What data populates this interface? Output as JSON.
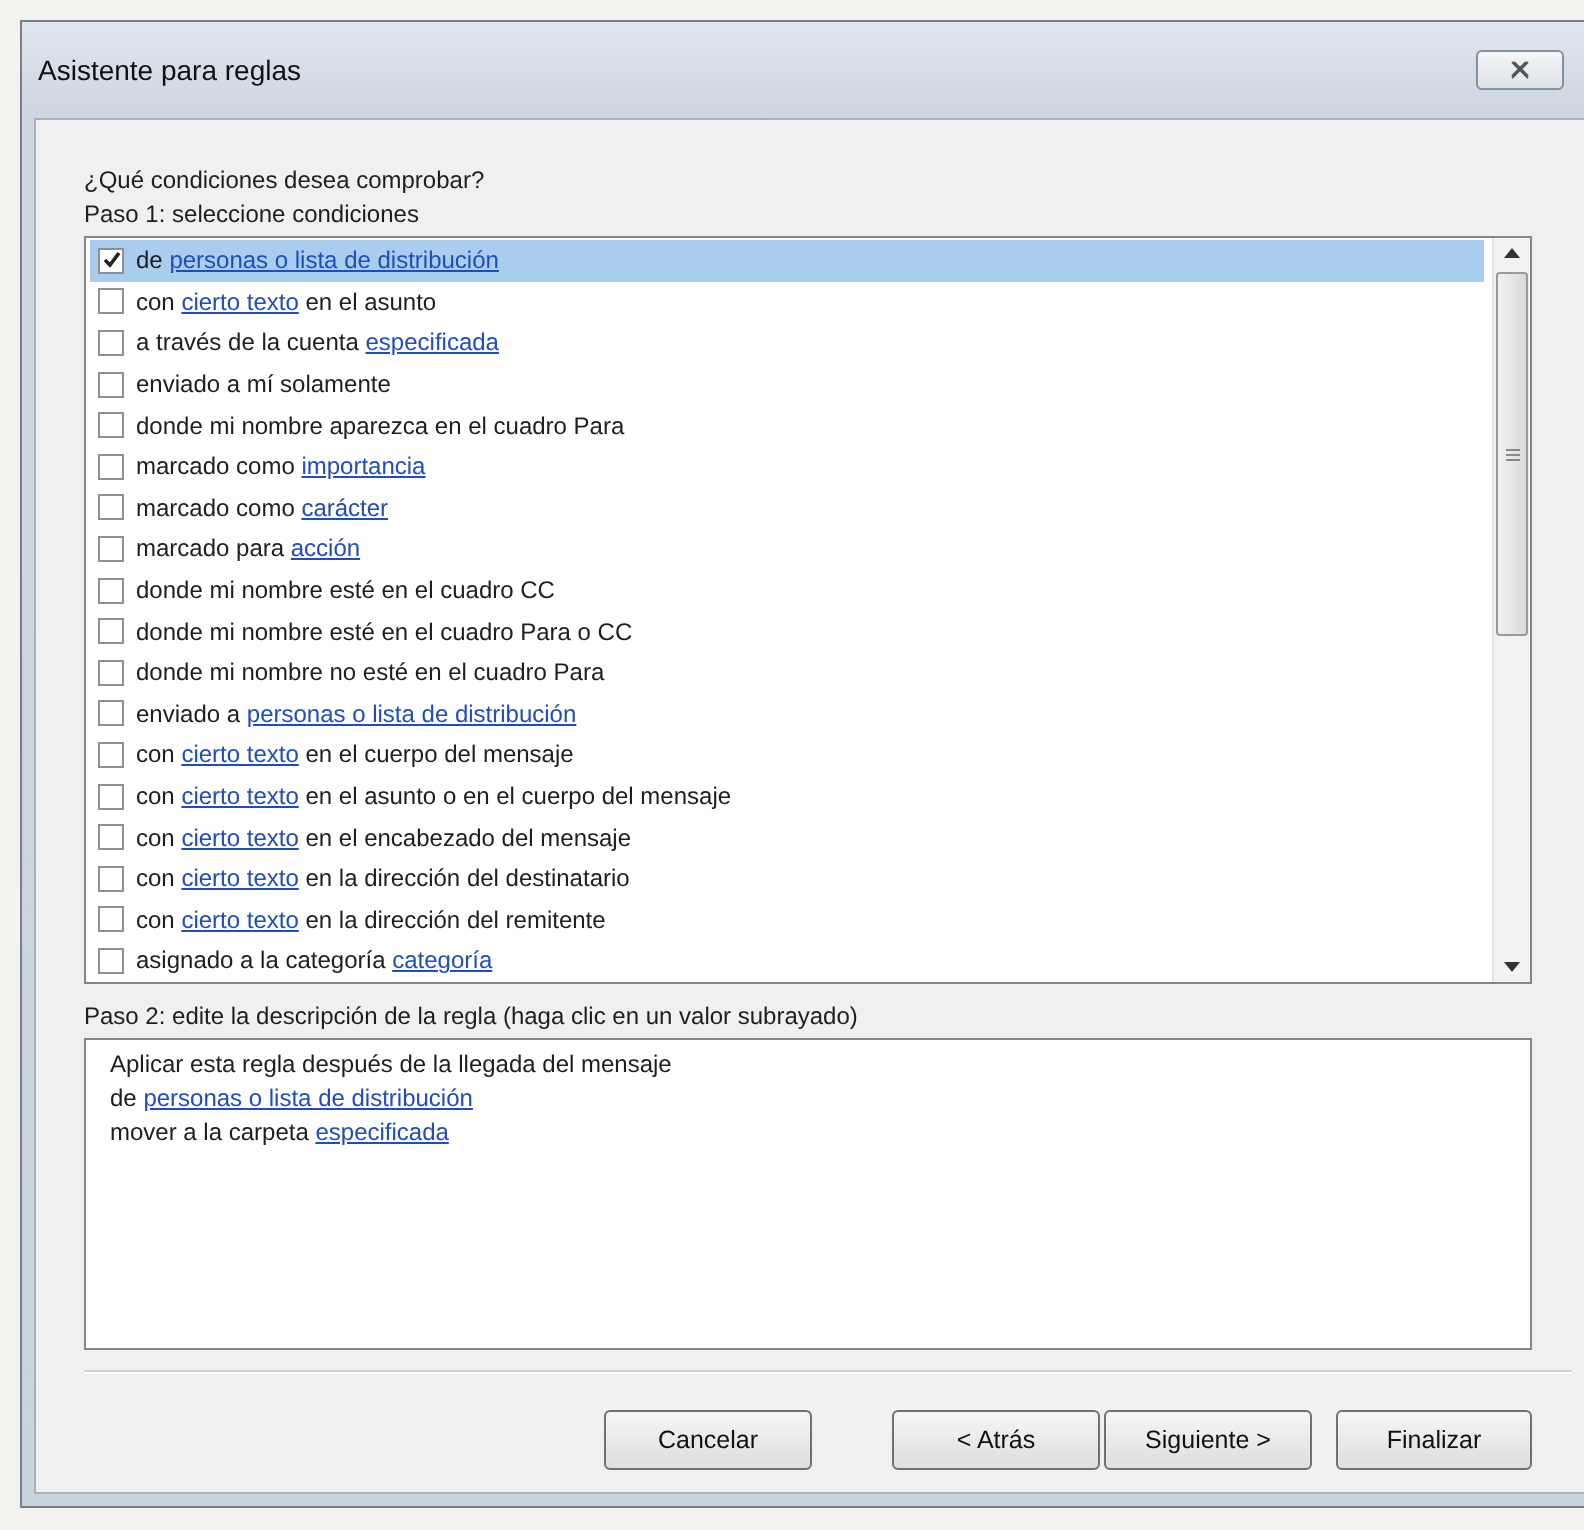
{
  "window": {
    "title": "Asistente para reglas"
  },
  "prompt": "¿Qué condiciones desea comprobar?",
  "step1": {
    "label": "Paso 1: seleccione condiciones",
    "conditions": [
      {
        "checked": true,
        "selected": true,
        "parts": [
          {
            "text": "de ",
            "link": false
          },
          {
            "text": "personas o lista de distribución",
            "link": true
          }
        ]
      },
      {
        "checked": false,
        "selected": false,
        "parts": [
          {
            "text": "con ",
            "link": false
          },
          {
            "text": "cierto texto",
            "link": true
          },
          {
            "text": " en el asunto",
            "link": false
          }
        ]
      },
      {
        "checked": false,
        "selected": false,
        "parts": [
          {
            "text": "a través de la cuenta ",
            "link": false
          },
          {
            "text": "especificada",
            "link": true
          }
        ]
      },
      {
        "checked": false,
        "selected": false,
        "parts": [
          {
            "text": "enviado a mí solamente",
            "link": false
          }
        ]
      },
      {
        "checked": false,
        "selected": false,
        "parts": [
          {
            "text": "donde mi nombre aparezca en el cuadro Para",
            "link": false
          }
        ]
      },
      {
        "checked": false,
        "selected": false,
        "parts": [
          {
            "text": "marcado como ",
            "link": false
          },
          {
            "text": "importancia",
            "link": true
          }
        ]
      },
      {
        "checked": false,
        "selected": false,
        "parts": [
          {
            "text": "marcado como ",
            "link": false
          },
          {
            "text": "carácter",
            "link": true
          }
        ]
      },
      {
        "checked": false,
        "selected": false,
        "parts": [
          {
            "text": "marcado para ",
            "link": false
          },
          {
            "text": "acción",
            "link": true
          }
        ]
      },
      {
        "checked": false,
        "selected": false,
        "parts": [
          {
            "text": "donde mi nombre esté en el cuadro CC",
            "link": false
          }
        ]
      },
      {
        "checked": false,
        "selected": false,
        "parts": [
          {
            "text": "donde mi nombre esté en el cuadro Para o CC",
            "link": false
          }
        ]
      },
      {
        "checked": false,
        "selected": false,
        "parts": [
          {
            "text": "donde mi nombre no esté en el cuadro Para",
            "link": false
          }
        ]
      },
      {
        "checked": false,
        "selected": false,
        "parts": [
          {
            "text": "enviado a ",
            "link": false
          },
          {
            "text": "personas o lista de distribución",
            "link": true
          }
        ]
      },
      {
        "checked": false,
        "selected": false,
        "parts": [
          {
            "text": "con ",
            "link": false
          },
          {
            "text": "cierto texto",
            "link": true
          },
          {
            "text": " en el cuerpo del mensaje",
            "link": false
          }
        ]
      },
      {
        "checked": false,
        "selected": false,
        "parts": [
          {
            "text": "con ",
            "link": false
          },
          {
            "text": "cierto texto",
            "link": true
          },
          {
            "text": " en el asunto o en el cuerpo del mensaje",
            "link": false
          }
        ]
      },
      {
        "checked": false,
        "selected": false,
        "parts": [
          {
            "text": "con ",
            "link": false
          },
          {
            "text": "cierto texto",
            "link": true
          },
          {
            "text": " en el encabezado del mensaje",
            "link": false
          }
        ]
      },
      {
        "checked": false,
        "selected": false,
        "parts": [
          {
            "text": "con ",
            "link": false
          },
          {
            "text": "cierto texto",
            "link": true
          },
          {
            "text": " en la dirección del destinatario",
            "link": false
          }
        ]
      },
      {
        "checked": false,
        "selected": false,
        "parts": [
          {
            "text": "con ",
            "link": false
          },
          {
            "text": "cierto texto",
            "link": true
          },
          {
            "text": " en la dirección del remitente",
            "link": false
          }
        ]
      },
      {
        "checked": false,
        "selected": false,
        "parts": [
          {
            "text": "asignado a la categoría ",
            "link": false
          },
          {
            "text": "categoría",
            "link": true
          }
        ]
      }
    ]
  },
  "step2": {
    "label": "Paso 2: edite la descripción de la regla (haga clic en un valor subrayado)",
    "lines": [
      {
        "parts": [
          {
            "text": "Aplicar esta regla después de la llegada del mensaje",
            "link": false
          }
        ]
      },
      {
        "parts": [
          {
            "text": "de ",
            "link": false
          },
          {
            "text": "personas o lista de distribución",
            "link": true
          }
        ]
      },
      {
        "parts": [
          {
            "text": "mover a la carpeta ",
            "link": false
          },
          {
            "text": "especificada",
            "link": true
          }
        ]
      }
    ]
  },
  "buttons": [
    {
      "label": "Cancelar"
    },
    {
      "label": "< Atrás"
    },
    {
      "label": "Siguiente >"
    },
    {
      "label": "Finalizar"
    }
  ]
}
